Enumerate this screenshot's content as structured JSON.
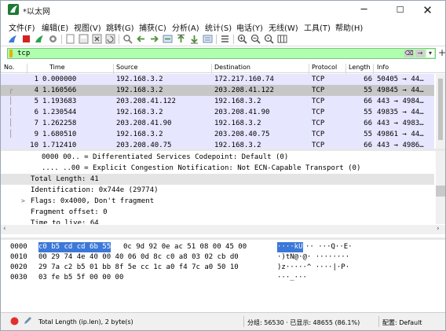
{
  "window": {
    "title": "*以太网",
    "controls": {
      "minimize": "─",
      "maximize": "☐",
      "close": "✕"
    }
  },
  "menu": [
    "文件(F)",
    "编辑(E)",
    "视图(V)",
    "跳转(G)",
    "捕获(C)",
    "分析(A)",
    "统计(S)",
    "电话(Y)",
    "无线(W)",
    "工具(T)",
    "帮助(H)"
  ],
  "toolbar": {
    "icons": [
      "shark-fin-start-icon",
      "stop-square-icon",
      "restart-icon",
      "gear-options-icon",
      "open-file-icon",
      "save-file-icon",
      "close-file-icon",
      "reload-icon",
      "find-packet-icon",
      "go-back-icon",
      "go-forward-icon",
      "go-to-packet-icon",
      "go-first-icon",
      "go-last-icon",
      "autoscroll-icon",
      "colorize-icon",
      "zoom-in-icon",
      "zoom-out-icon",
      "zoom-normal-icon",
      "resize-columns-icon"
    ]
  },
  "filter": {
    "value": "tcp",
    "clear_label": "⌫",
    "apply_label": "→",
    "dropdown_label": "▾",
    "add_label": "+"
  },
  "packet_list": {
    "columns": [
      "No.",
      "Time",
      "Source",
      "Destination",
      "Protocol",
      "Length",
      "Info"
    ],
    "rows": [
      {
        "no": "1",
        "time": "0.000000",
        "source": "192.168.3.2",
        "destination": "172.217.160.74",
        "protocol": "TCP",
        "length": "66",
        "info": "50405 → 44…"
      },
      {
        "no": "4",
        "time": "1.160566",
        "source": "192.168.3.2",
        "destination": "203.208.41.122",
        "protocol": "TCP",
        "length": "55",
        "info": "49845 → 44…",
        "selected": true
      },
      {
        "no": "5",
        "time": "1.193683",
        "source": "203.208.41.122",
        "destination": "192.168.3.2",
        "protocol": "TCP",
        "length": "66",
        "info": "443 → 4984…"
      },
      {
        "no": "6",
        "time": "1.230544",
        "source": "192.168.3.2",
        "destination": "203.208.41.90",
        "protocol": "TCP",
        "length": "55",
        "info": "49835 → 44…"
      },
      {
        "no": "7",
        "time": "1.262258",
        "source": "203.208.41.90",
        "destination": "192.168.3.2",
        "protocol": "TCP",
        "length": "66",
        "info": "443 → 4983…"
      },
      {
        "no": "9",
        "time": "1.680510",
        "source": "192.168.3.2",
        "destination": "203.208.40.75",
        "protocol": "TCP",
        "length": "55",
        "info": "49861 → 44…"
      },
      {
        "no": "10",
        "time": "1.712410",
        "source": "203.208.40.75",
        "destination": "192.168.3.2",
        "protocol": "TCP",
        "length": "66",
        "info": "443 → 4986…"
      }
    ]
  },
  "details": [
    {
      "text": "0000 00.. = Differentiated Services Codepoint: Default (0)"
    },
    {
      "text": ".... ..00 = Explicit Congestion Notification: Not ECN-Capable Transport (0)"
    },
    {
      "text": "Total Length: 41"
    },
    {
      "text": "Identification: 0x744e (29774)"
    },
    {
      "text": "Flags: 0x4000, Don't fragment"
    },
    {
      "text": "Fragment offset: 0"
    },
    {
      "text": "Time to live: 64"
    }
  ],
  "bytes": [
    {
      "offset": "0000",
      "hex_sel": "c0 b5 cd cd 6b 55",
      "hex_rest": "0c 9d  92 0e ac 51 08 00 45 00",
      "ascii_sel": "····kU",
      "ascii_rest": "·· ···Q··E·"
    },
    {
      "offset": "0010",
      "hex_sel": "",
      "hex_rest": "00 29 74 4e 40 00 40 06  0d 8c c0 a8 03 02 cb d0",
      "ascii_sel": "",
      "ascii_rest": "·)tN@·@· ········"
    },
    {
      "offset": "0020",
      "hex_sel": "",
      "hex_rest": "29 7a c2 b5 01 bb 8f 5e  cc 1c a0 f4 7c a0 50 10",
      "ascii_sel": "",
      "ascii_rest": ")z·····^ ····|·P·"
    },
    {
      "offset": "0030",
      "hex_sel": "",
      "hex_rest": "03 fe b5 5f 00 00 00",
      "ascii_sel": "",
      "ascii_rest": "···_···"
    }
  ],
  "status": {
    "field": "Total Length (ip.len), 2 byte(s)",
    "packets": "分组: 56530 · 已显示: 48655 (86.1%)",
    "profile": "配置: Default"
  },
  "colors": {
    "filter_ok": "#afffaf",
    "tcp_row": "#e7e6ff",
    "selected_row": "#c7c7c7",
    "hex_selection": "#3c78d8"
  }
}
